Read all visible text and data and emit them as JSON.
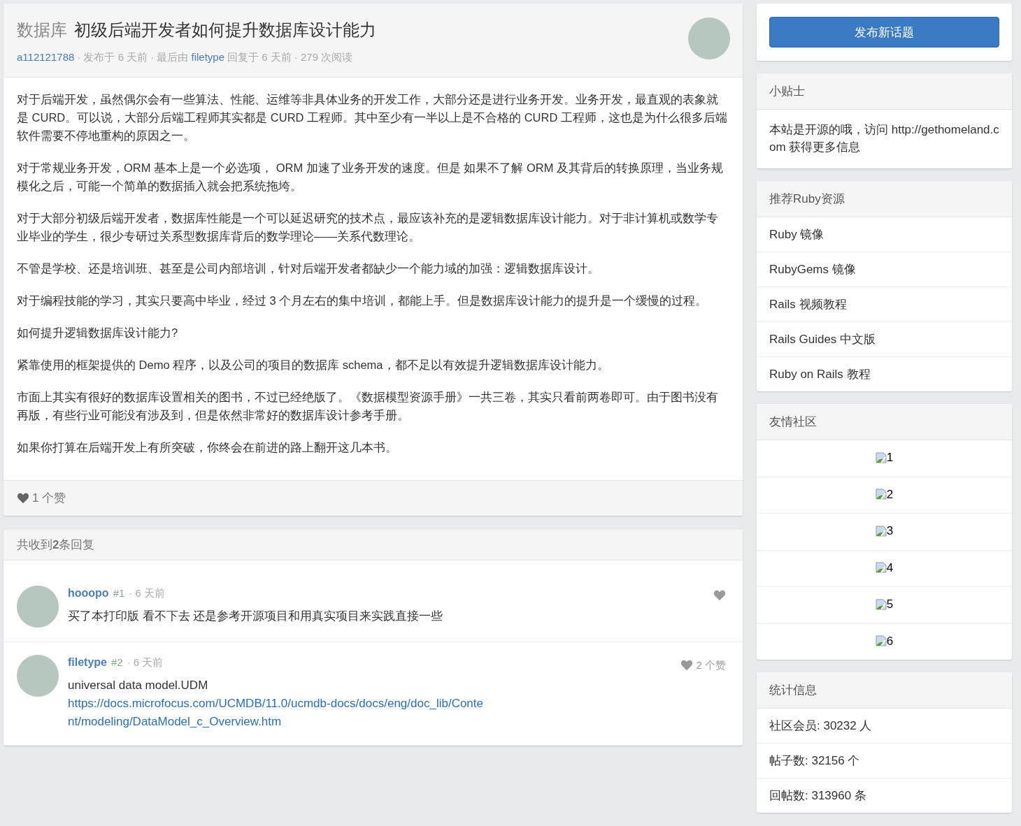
{
  "topic": {
    "node": "数据库",
    "title": "初级后端开发者如何提升数据库设计能力",
    "author": "a112121788",
    "posted": "· 发布于 6 天前 · 最后由",
    "last_replier": "filetype",
    "replied": "回复于 6 天前 · 279 次阅读",
    "paragraphs": [
      "对于后端开发，虽然偶尔会有一些算法、性能、运维等非具体业务的开发工作，大部分还是进行业务开发。业务开发，最直观的表象就是 CURD。可以说，大部分后端工程师其实都是 CURD 工程师。其中至少有一半以上是不合格的 CURD 工程师，这也是为什么很多后端软件需要不停地重构的原因之一。",
      "对于常规业务开发，ORM 基本上是一个必选项， ORM 加速了业务开发的速度。但是 如果不了解 ORM 及其背后的转换原理，当业务规模化之后，可能一个简单的数据插入就会把系统拖垮。",
      "对于大部分初级后端开发者，数据库性能是一个可以延迟研究的技术点，最应该补充的是逻辑数据库设计能力。对于非计算机或数学专业毕业的学生，很少专研过关系型数据库背后的数学理论——关系代数理论。",
      "不管是学校、还是培训班、甚至是公司内部培训，针对后端开发者都缺少一个能力域的加强：逻辑数据库设计。",
      "对于编程技能的学习，其实只要高中毕业，经过 3 个月左右的集中培训，都能上手。但是数据库设计能力的提升是一个缓慢的过程。",
      "如何提升逻辑数据库设计能力?",
      "紧靠使用的框架提供的 Demo 程序，以及公司的项目的数据库 schema，都不足以有效提升逻辑数据库设计能力。",
      "市面上其实有很好的数据库设置相关的图书，不过已经绝版了。《数据模型资源手册》一共三卷，其实只看前两卷即可。由于图书没有再版，有些行业可能没有涉及到，但是依然非常好的数据库设计参考手册。",
      "如果你打算在后端开发上有所突破，你终会在前进的路上翻开这几本书。"
    ],
    "likes": "1 个赞"
  },
  "replies": {
    "heading": "共收到**2**条回复",
    "items": [
      {
        "user": "hooopo",
        "floor": "#1",
        "time": "· 6 天前",
        "text": "买了本打印版 看不下去 还是参考开源项目和用真实项目来实践直接一些"
      },
      {
        "user": "filetype",
        "floor": "#2",
        "time": "· 6 天前",
        "text": "universal data model.UDM",
        "link": "https://docs.microfocus.com/UCMDB/11.0/ucmdb-docs/docs/eng/doc_lib/Content/modeling/DataModel_c_Overview.htm",
        "likes": "2 个赞"
      }
    ]
  },
  "sidebar": {
    "new_topic_button": "发布新话题",
    "tips": {
      "title": "小贴士",
      "text": "本站是开源的哦，访问 http://gethomeland.com 获得更多信息"
    },
    "ruby_resources": {
      "title": "推荐Ruby资源",
      "items": [
        "Ruby 镜像",
        "RubyGems 镜像",
        "Rails 视频教程",
        "Rails Guides 中文版",
        "Ruby on Rails 教程"
      ]
    },
    "communities": {
      "title": "友情社区",
      "items": [
        "1",
        "2",
        "3",
        "4",
        "5",
        "6"
      ]
    },
    "stats": {
      "title": "统计信息",
      "items": [
        "社区会员: 30232 人",
        "帖子数: 32156 个",
        "回帖数: 313960 条"
      ]
    }
  }
}
